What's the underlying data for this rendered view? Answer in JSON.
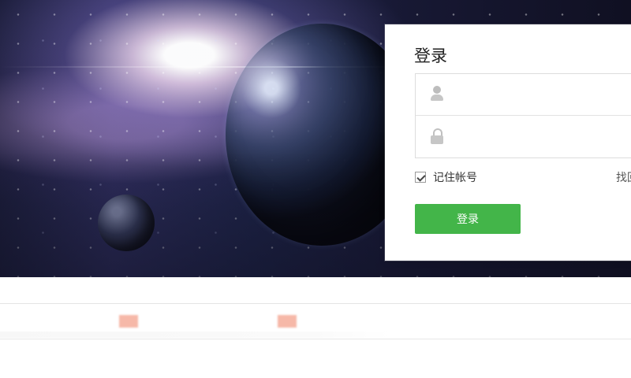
{
  "hero": {
    "caption": "",
    "accent_colors": {
      "space_dark": "#1b1d3a",
      "glow": "#ffffff",
      "login_button": "#43b549",
      "notice_chip": "#f6b8a8"
    }
  },
  "login": {
    "title": "登录",
    "username": {
      "value": "",
      "placeholder": ""
    },
    "password": {
      "value": "",
      "placeholder": ""
    },
    "remember_label": "记住帐号",
    "remember_checked": true,
    "find_link": "找回",
    "submit_label": "登录"
  },
  "notice": {
    "left_text": "",
    "right_text": ""
  },
  "icons": {
    "user": "user-icon",
    "lock": "lock-icon",
    "check": "check-icon"
  }
}
